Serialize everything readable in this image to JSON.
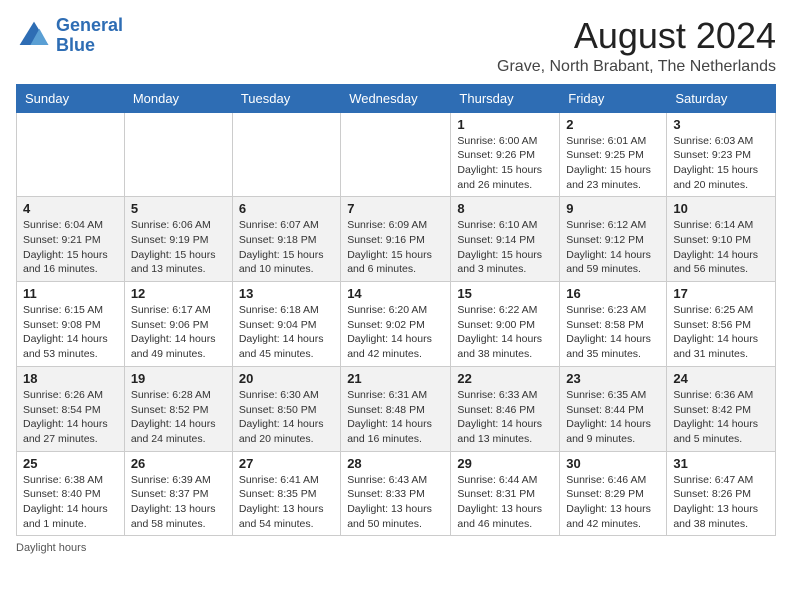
{
  "header": {
    "logo_line1": "General",
    "logo_line2": "Blue",
    "main_title": "August 2024",
    "subtitle": "Grave, North Brabant, The Netherlands"
  },
  "days_of_week": [
    "Sunday",
    "Monday",
    "Tuesday",
    "Wednesday",
    "Thursday",
    "Friday",
    "Saturday"
  ],
  "footer": {
    "note": "Daylight hours"
  },
  "weeks": [
    [
      {
        "day": "",
        "sunrise": "",
        "sunset": "",
        "daylight": ""
      },
      {
        "day": "",
        "sunrise": "",
        "sunset": "",
        "daylight": ""
      },
      {
        "day": "",
        "sunrise": "",
        "sunset": "",
        "daylight": ""
      },
      {
        "day": "",
        "sunrise": "",
        "sunset": "",
        "daylight": ""
      },
      {
        "day": "1",
        "sunrise": "Sunrise: 6:00 AM",
        "sunset": "Sunset: 9:26 PM",
        "daylight": "Daylight: 15 hours and 26 minutes."
      },
      {
        "day": "2",
        "sunrise": "Sunrise: 6:01 AM",
        "sunset": "Sunset: 9:25 PM",
        "daylight": "Daylight: 15 hours and 23 minutes."
      },
      {
        "day": "3",
        "sunrise": "Sunrise: 6:03 AM",
        "sunset": "Sunset: 9:23 PM",
        "daylight": "Daylight: 15 hours and 20 minutes."
      }
    ],
    [
      {
        "day": "4",
        "sunrise": "Sunrise: 6:04 AM",
        "sunset": "Sunset: 9:21 PM",
        "daylight": "Daylight: 15 hours and 16 minutes."
      },
      {
        "day": "5",
        "sunrise": "Sunrise: 6:06 AM",
        "sunset": "Sunset: 9:19 PM",
        "daylight": "Daylight: 15 hours and 13 minutes."
      },
      {
        "day": "6",
        "sunrise": "Sunrise: 6:07 AM",
        "sunset": "Sunset: 9:18 PM",
        "daylight": "Daylight: 15 hours and 10 minutes."
      },
      {
        "day": "7",
        "sunrise": "Sunrise: 6:09 AM",
        "sunset": "Sunset: 9:16 PM",
        "daylight": "Daylight: 15 hours and 6 minutes."
      },
      {
        "day": "8",
        "sunrise": "Sunrise: 6:10 AM",
        "sunset": "Sunset: 9:14 PM",
        "daylight": "Daylight: 15 hours and 3 minutes."
      },
      {
        "day": "9",
        "sunrise": "Sunrise: 6:12 AM",
        "sunset": "Sunset: 9:12 PM",
        "daylight": "Daylight: 14 hours and 59 minutes."
      },
      {
        "day": "10",
        "sunrise": "Sunrise: 6:14 AM",
        "sunset": "Sunset: 9:10 PM",
        "daylight": "Daylight: 14 hours and 56 minutes."
      }
    ],
    [
      {
        "day": "11",
        "sunrise": "Sunrise: 6:15 AM",
        "sunset": "Sunset: 9:08 PM",
        "daylight": "Daylight: 14 hours and 53 minutes."
      },
      {
        "day": "12",
        "sunrise": "Sunrise: 6:17 AM",
        "sunset": "Sunset: 9:06 PM",
        "daylight": "Daylight: 14 hours and 49 minutes."
      },
      {
        "day": "13",
        "sunrise": "Sunrise: 6:18 AM",
        "sunset": "Sunset: 9:04 PM",
        "daylight": "Daylight: 14 hours and 45 minutes."
      },
      {
        "day": "14",
        "sunrise": "Sunrise: 6:20 AM",
        "sunset": "Sunset: 9:02 PM",
        "daylight": "Daylight: 14 hours and 42 minutes."
      },
      {
        "day": "15",
        "sunrise": "Sunrise: 6:22 AM",
        "sunset": "Sunset: 9:00 PM",
        "daylight": "Daylight: 14 hours and 38 minutes."
      },
      {
        "day": "16",
        "sunrise": "Sunrise: 6:23 AM",
        "sunset": "Sunset: 8:58 PM",
        "daylight": "Daylight: 14 hours and 35 minutes."
      },
      {
        "day": "17",
        "sunrise": "Sunrise: 6:25 AM",
        "sunset": "Sunset: 8:56 PM",
        "daylight": "Daylight: 14 hours and 31 minutes."
      }
    ],
    [
      {
        "day": "18",
        "sunrise": "Sunrise: 6:26 AM",
        "sunset": "Sunset: 8:54 PM",
        "daylight": "Daylight: 14 hours and 27 minutes."
      },
      {
        "day": "19",
        "sunrise": "Sunrise: 6:28 AM",
        "sunset": "Sunset: 8:52 PM",
        "daylight": "Daylight: 14 hours and 24 minutes."
      },
      {
        "day": "20",
        "sunrise": "Sunrise: 6:30 AM",
        "sunset": "Sunset: 8:50 PM",
        "daylight": "Daylight: 14 hours and 20 minutes."
      },
      {
        "day": "21",
        "sunrise": "Sunrise: 6:31 AM",
        "sunset": "Sunset: 8:48 PM",
        "daylight": "Daylight: 14 hours and 16 minutes."
      },
      {
        "day": "22",
        "sunrise": "Sunrise: 6:33 AM",
        "sunset": "Sunset: 8:46 PM",
        "daylight": "Daylight: 14 hours and 13 minutes."
      },
      {
        "day": "23",
        "sunrise": "Sunrise: 6:35 AM",
        "sunset": "Sunset: 8:44 PM",
        "daylight": "Daylight: 14 hours and 9 minutes."
      },
      {
        "day": "24",
        "sunrise": "Sunrise: 6:36 AM",
        "sunset": "Sunset: 8:42 PM",
        "daylight": "Daylight: 14 hours and 5 minutes."
      }
    ],
    [
      {
        "day": "25",
        "sunrise": "Sunrise: 6:38 AM",
        "sunset": "Sunset: 8:40 PM",
        "daylight": "Daylight: 14 hours and 1 minute."
      },
      {
        "day": "26",
        "sunrise": "Sunrise: 6:39 AM",
        "sunset": "Sunset: 8:37 PM",
        "daylight": "Daylight: 13 hours and 58 minutes."
      },
      {
        "day": "27",
        "sunrise": "Sunrise: 6:41 AM",
        "sunset": "Sunset: 8:35 PM",
        "daylight": "Daylight: 13 hours and 54 minutes."
      },
      {
        "day": "28",
        "sunrise": "Sunrise: 6:43 AM",
        "sunset": "Sunset: 8:33 PM",
        "daylight": "Daylight: 13 hours and 50 minutes."
      },
      {
        "day": "29",
        "sunrise": "Sunrise: 6:44 AM",
        "sunset": "Sunset: 8:31 PM",
        "daylight": "Daylight: 13 hours and 46 minutes."
      },
      {
        "day": "30",
        "sunrise": "Sunrise: 6:46 AM",
        "sunset": "Sunset: 8:29 PM",
        "daylight": "Daylight: 13 hours and 42 minutes."
      },
      {
        "day": "31",
        "sunrise": "Sunrise: 6:47 AM",
        "sunset": "Sunset: 8:26 PM",
        "daylight": "Daylight: 13 hours and 38 minutes."
      }
    ]
  ]
}
